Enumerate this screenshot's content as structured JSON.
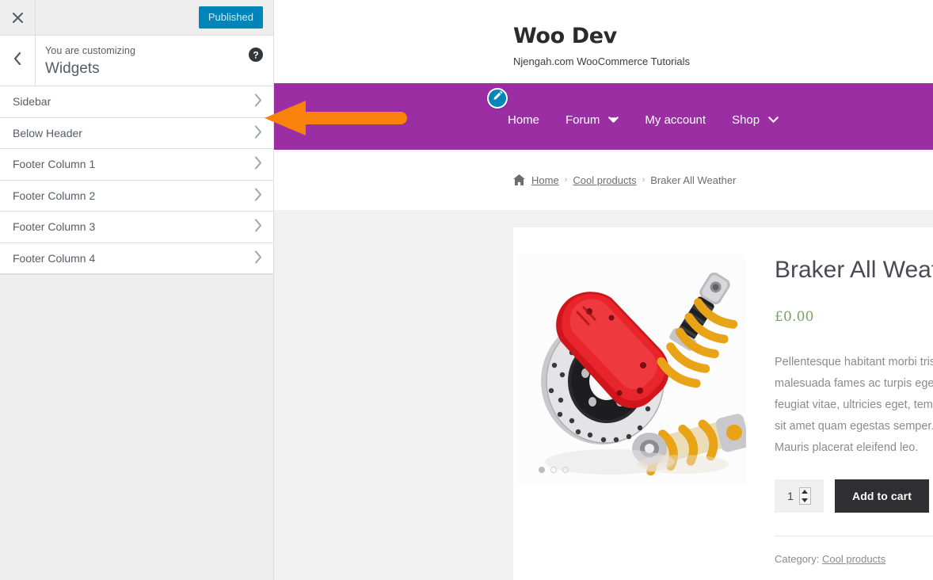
{
  "customizer": {
    "close_icon": "close-icon",
    "publish_label": "Published",
    "back_icon": "chevron-left-icon",
    "eyebrow": "You are customizing",
    "title": "Widgets",
    "help_icon": "help-icon",
    "accent_blue": "#0085ba",
    "panel_bg": "#eeeeee",
    "items": [
      {
        "label": "Sidebar",
        "chevron": "chevron-right-icon"
      },
      {
        "label": "Below Header",
        "chevron": "chevron-right-icon"
      },
      {
        "label": "Footer Column 1",
        "chevron": "chevron-right-icon"
      },
      {
        "label": "Footer Column 2",
        "chevron": "chevron-right-icon"
      },
      {
        "label": "Footer Column 3",
        "chevron": "chevron-right-icon"
      },
      {
        "label": "Footer Column 4",
        "chevron": "chevron-right-icon"
      }
    ]
  },
  "annotation": {
    "arrow_color": "#f8820b",
    "points_to": "Sidebar"
  },
  "preview": {
    "site": {
      "title": "Woo Dev",
      "description": "Njengah.com WooCommerce Tutorials"
    },
    "nav": {
      "bar_color": "#9c2ea4",
      "edit_shortcut_icon": "pencil-edit-icon",
      "items": [
        {
          "label": "Home",
          "has_caret": false
        },
        {
          "label": "Forum",
          "has_caret": true
        },
        {
          "label": "My account",
          "has_caret": false
        },
        {
          "label": "Shop",
          "has_caret": true
        }
      ]
    },
    "breadcrumb": {
      "home_icon": "house-icon",
      "home": "Home",
      "separator": "›",
      "category": "Cool products",
      "current": "Braker All Weather"
    },
    "product": {
      "gallery_icon": "brake-disc-suspension-photo",
      "gallery_dots": 3,
      "gallery_active_dot": 0,
      "title": "Braker All Weather",
      "price": "£0.00",
      "price_color": "#77a464",
      "description": "Pellentesque habitant morbi tristique senectus et netus et malesuada fames ac turpis egestas. Vestibulum tortor quam, feugiat vitae, ultricies eget, tempor sit amet, ante. Donec eu libero sit amet quam egestas semper. Aenean ultricies mi vitae est. Mauris placerat eleifend leo.",
      "quantity_value": "1",
      "stepper_up_icon": "caret-up-icon",
      "stepper_down_icon": "caret-down-icon",
      "add_to_cart_label": "Add to cart",
      "meta_label": "Category:",
      "meta_value": "Cool products"
    }
  }
}
